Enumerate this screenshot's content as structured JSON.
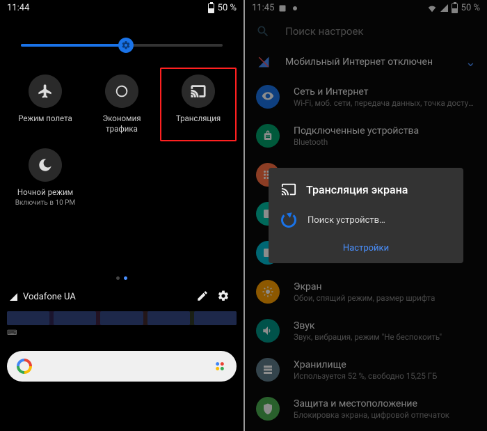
{
  "left": {
    "status": {
      "time": "11:44",
      "battery": "50 %"
    },
    "tiles": [
      {
        "label": "Режим полета"
      },
      {
        "label": "Экономия трафика"
      },
      {
        "label": "Трансляция"
      },
      {
        "label": "Ночной режим",
        "sub": "Включить в 10 PM"
      }
    ],
    "carrier": "Vodafone UA"
  },
  "right": {
    "status": {
      "time": "11:45",
      "battery": "50 %"
    },
    "search_placeholder": "Поиск настроек",
    "banner": {
      "title": "Мобильный Интернет отключен"
    },
    "rows": [
      {
        "title": "Сеть и Интернет",
        "sub": "Wi-Fi, моб. сети, передача данных, точка доступа",
        "color": "#1a73e8"
      },
      {
        "title": "Подключенные устройства",
        "sub": "Bluetooth",
        "color": "#00a36c"
      },
      {
        "title": "",
        "sub": "",
        "color": "#ff7043"
      },
      {
        "title": "",
        "sub": "",
        "color": "#00bfa5"
      },
      {
        "title": "",
        "sub": "",
        "color": "#00bcd4"
      },
      {
        "title": "Экран",
        "sub": "Обои, спящий режим, размер шрифта",
        "color": "#ffa000"
      },
      {
        "title": "Звук",
        "sub": "Звук, вибрация, режим \"Не беспокоить\"",
        "color": "#009688"
      },
      {
        "title": "Хранилище",
        "sub": "Используется 52 %, свободно 15,25 ГБ",
        "color": "#607d8b"
      },
      {
        "title": "Защита и местоположение",
        "sub": "Блокировка экрана, цифровой отпечаток",
        "color": "#4caf50"
      }
    ],
    "modal": {
      "title": "Трансляция экрана",
      "searching": "Поиск устройств…",
      "link": "Настройки"
    }
  }
}
